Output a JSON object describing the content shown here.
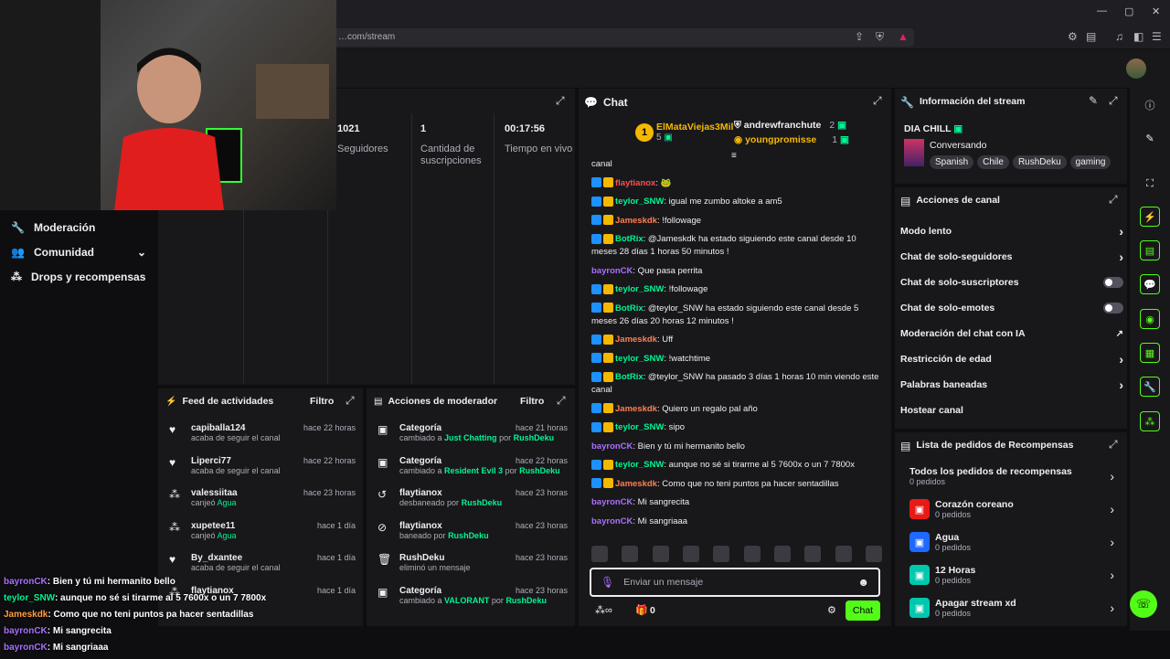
{
  "browser": {
    "url": "…com/stream",
    "window_controls": [
      "—",
      "▢",
      "✕"
    ]
  },
  "webcam_alt": "webcam",
  "nav": {
    "items": [
      {
        "label": "Moderación",
        "icon": "wrench-icon"
      },
      {
        "label": "Comunidad",
        "icon": "community-icon",
        "expand": "chevron-down-icon"
      },
      {
        "label": "Drops y recompensas",
        "icon": "drops-icon"
      }
    ]
  },
  "stats": [
    {
      "value": "1021",
      "label": "Seguidores"
    },
    {
      "value": "1",
      "label": "Cantidad de suscripciones"
    },
    {
      "value": "00:17:56",
      "label": "Tiempo en vivo"
    }
  ],
  "activity_feed": {
    "title": "Feed de actividades",
    "filter": "Filtro",
    "items": [
      {
        "name": "capiballa124",
        "sub": "acaba de seguir el canal",
        "highlight": "",
        "time": "hace 22 horas",
        "icon": "heart-icon"
      },
      {
        "name": "Liperci77",
        "sub": "acaba de seguir el canal",
        "highlight": "",
        "time": "hace 22 horas",
        "icon": "heart-icon"
      },
      {
        "name": "valessiitaa",
        "sub": "canjeó",
        "highlight": "Agua",
        "time": "hace 23 horas",
        "icon": "points-icon"
      },
      {
        "name": "xupetee11",
        "sub": "canjeó",
        "highlight": "Agua",
        "time": "hace 1 día",
        "icon": "points-icon"
      },
      {
        "name": "By_dxantee",
        "sub": "acaba de seguir el canal",
        "highlight": "",
        "time": "hace 1 día",
        "icon": "heart-icon"
      },
      {
        "name": "flaytianox",
        "sub": "",
        "highlight": "",
        "time": "hace 1 día",
        "icon": "points-icon"
      }
    ]
  },
  "mod_actions": {
    "title": "Acciones de moderador",
    "filter": "Filtro",
    "items": [
      {
        "name": "Categoría",
        "pre": "cambiado a",
        "target": "Just Chatting",
        "mid": "por",
        "by": "RushDeku",
        "time": "hace 21 horas",
        "icon": "category-icon"
      },
      {
        "name": "Categoría",
        "pre": "cambiado a",
        "target": "Resident Evil 3",
        "mid": "por",
        "by": "RushDeku",
        "time": "hace 22 horas",
        "icon": "category-icon"
      },
      {
        "name": "flaytianox",
        "pre": "desbaneado por",
        "target": "",
        "mid": "",
        "by": "RushDeku",
        "time": "hace 23 horas",
        "icon": "unban-icon"
      },
      {
        "name": "flaytianox",
        "pre": "baneado por",
        "target": "",
        "mid": "",
        "by": "RushDeku",
        "time": "hace 23 horas",
        "icon": "ban-icon"
      },
      {
        "name": "RushDeku",
        "pre": "eliminó un mensaje",
        "target": "",
        "mid": "",
        "by": "",
        "time": "hace 23 horas",
        "icon": "delete-icon"
      },
      {
        "name": "Categoría",
        "pre": "cambiado a",
        "target": "VALORANT",
        "mid": "por",
        "by": "RushDeku",
        "time": "hace 23 horas",
        "icon": "category-icon"
      }
    ]
  },
  "chat": {
    "title": "Chat",
    "leaderboard": [
      {
        "rank": "1",
        "name": "ElMataViejas3Mil",
        "count": "5"
      },
      {
        "name": "andrewfranchute",
        "count": "2"
      },
      {
        "name": "youngpromisse",
        "count": "1"
      }
    ],
    "messages": [
      {
        "user": "",
        "text": "canal",
        "color": "#efeff1"
      },
      {
        "user": "flaytianox",
        "text": ": 🐸",
        "color": "#ff4f4f"
      },
      {
        "user": "teylor_SNW",
        "text": ": igual me zumbo altoke a am5",
        "color": "#00f593"
      },
      {
        "user": "Jameskdk",
        "text": ": !followage",
        "color": "#ff7f50"
      },
      {
        "user": "BotRix",
        "text": ": @Jameskdk ha estado siguiendo este canal desde 10 meses 28 días 1 horas 50 minutos !",
        "color": "#00f593"
      },
      {
        "user": "bayronCK",
        "text": ": Que pasa perrita",
        "color": "#a970ff"
      },
      {
        "user": "teylor_SNW",
        "text": ": !followage",
        "color": "#00f593"
      },
      {
        "user": "BotRix",
        "text": ": @teylor_SNW ha estado siguiendo este canal desde 5 meses 26 días 20 horas 12 minutos !",
        "color": "#00f593"
      },
      {
        "user": "Jameskdk",
        "text": ": Uff",
        "color": "#ff7f50"
      },
      {
        "user": "teylor_SNW",
        "text": ": !watchtime",
        "color": "#00f593"
      },
      {
        "user": "BotRix",
        "text": ": @teylor_SNW ha pasado 3 días 1 horas 10 min viendo este canal",
        "color": "#00f593"
      },
      {
        "user": "Jameskdk",
        "text": ": Quiero un regalo pal año",
        "color": "#ff7f50"
      },
      {
        "user": "teylor_SNW",
        "text": ": sipo",
        "color": "#00f593"
      },
      {
        "user": "bayronCK",
        "text": ": Bien y tú mi hermanito bello",
        "color": "#a970ff"
      },
      {
        "user": "teylor_SNW",
        "text": ": aunque no sé si tirarme al 5 7600x o un 7 7800x",
        "color": "#00f593"
      },
      {
        "user": "Jameskdk",
        "text": ": Como que no teni puntos pa hacer sentadillas",
        "color": "#ff7f50"
      },
      {
        "user": "bayronCK",
        "text": ": Mi sangrecita",
        "color": "#a970ff"
      },
      {
        "user": "bayronCK",
        "text": ": Mi sangriaaa",
        "color": "#a970ff"
      }
    ],
    "input_placeholder": "Enviar un mensaje",
    "points": "0",
    "send_label": "Chat"
  },
  "stream_info": {
    "title": "Información del stream",
    "stream_title": "DIA CHILL",
    "category": "Conversando",
    "tags": [
      "Spanish",
      "Chile",
      "RushDeku",
      "gaming"
    ]
  },
  "channel_actions": {
    "title": "Acciones de canal",
    "items": [
      {
        "label": "Modo lento",
        "control": "chevron"
      },
      {
        "label": "Chat de solo-seguidores",
        "control": "chevron"
      },
      {
        "label": "Chat de solo-suscriptores",
        "control": "toggle"
      },
      {
        "label": "Chat de solo-emotes",
        "control": "toggle"
      },
      {
        "label": "Moderación del chat con IA",
        "control": "external"
      },
      {
        "label": "Restricción de edad",
        "control": "chevron"
      },
      {
        "label": "Palabras baneadas",
        "control": "chevron"
      },
      {
        "label": "Hostear canal",
        "control": "none"
      }
    ]
  },
  "rewards": {
    "title": "Lista de pedidos de Recompensas",
    "all_label": "Todos los pedidos de recompensas",
    "all_count": "0 pedidos",
    "items": [
      {
        "name": "Corazón coreano",
        "count": "0 pedidos",
        "color": "#e91916"
      },
      {
        "name": "Agua",
        "count": "0 pedidos",
        "color": "#1e69ff"
      },
      {
        "name": "12 Horas",
        "count": "0 pedidos",
        "color": "#00c8af"
      },
      {
        "name": "Apagar stream xd",
        "count": "0 pedidos",
        "color": "#00c8af"
      }
    ]
  },
  "overlay_chat": [
    {
      "user": "bayronCK",
      "text": ": Bien y tú mi hermanito bello",
      "color": "#a970ff"
    },
    {
      "user": "teylor_SNW",
      "text": ": aunque no sé si tirarme al 5 7600x o un 7 7800x",
      "color": "#00f593"
    },
    {
      "user": "Jameskdk",
      "text": ": Como que no teni puntos pa hacer sentadillas",
      "color": "#ff9f43"
    },
    {
      "user": "bayronCK",
      "text": ": Mi sangrecita",
      "color": "#a970ff"
    },
    {
      "user": "bayronCK",
      "text": ": Mi sangriaaa",
      "color": "#a970ff"
    }
  ],
  "colors": {
    "accent": "#53fc18",
    "kick_green": "#00f593",
    "bg": "#0e0e10",
    "panel": "#18181b"
  }
}
